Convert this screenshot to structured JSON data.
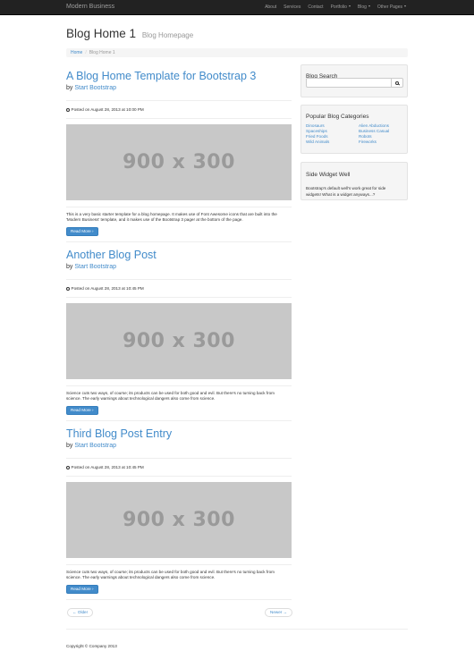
{
  "navbar": {
    "brand": "Modern Business",
    "items": [
      {
        "label": "About"
      },
      {
        "label": "Services"
      },
      {
        "label": "Contact"
      },
      {
        "label": "Portfolio"
      },
      {
        "label": "Blog"
      },
      {
        "label": "Other Pages"
      }
    ]
  },
  "header": {
    "title": "Blog Home 1",
    "subtitle": "Blog Homepage"
  },
  "breadcrumb": {
    "home": "Home",
    "current": "Blog Home 1"
  },
  "posts": [
    {
      "title": "A Blog Home Template for Bootstrap 3",
      "by": "by",
      "author": "Start Bootstrap",
      "posted": "Posted on August 28, 2013 at 10:00 PM",
      "image_label": "900 x 300",
      "excerpt": "This is a very basic starter template for a blog homepage. It makes use of Font Awesome icons that are built into the 'Modern Business' template, and it makes use of the Bootstrap 3 pager at the bottom of the page.",
      "button": "Read More"
    },
    {
      "title": "Another Blog Post",
      "by": "by",
      "author": "Start Bootstrap",
      "posted": "Posted on August 28, 2013 at 10:45 PM",
      "image_label": "900 x 300",
      "excerpt": "Science cuts two ways, of course; its products can be used for both good and evil. But there's no turning back from science. The early warnings about technological dangers also come from science.",
      "button": "Read More"
    },
    {
      "title": "Third Blog Post Entry",
      "by": "by",
      "author": "Start Bootstrap",
      "posted": "Posted on August 28, 2013 at 10:45 PM",
      "image_label": "900 x 300",
      "excerpt": "Science cuts two ways, of course; its products can be used for both good and evil. But there's no turning back from science. The early warnings about technological dangers also come from science.",
      "button": "Read More"
    }
  ],
  "pager": {
    "older": "← Older",
    "newer": "Newer →"
  },
  "footer": {
    "copyright": "Copyright © Company 2013"
  },
  "sidebar": {
    "search_title": "Blog Search",
    "categories_title": "Popular Blog Categories",
    "categories_left": [
      "Dinosaurs",
      "Spaceships",
      "Fried Foods",
      "Wild Animals"
    ],
    "categories_right": [
      "Alien Abductions",
      "Business Casual",
      "Robots",
      "Fireworks"
    ],
    "widget_title": "Side Widget Well",
    "widget_text": "Bootstrap's default well's work great for side widgets! What is a widget anyways...?"
  },
  "colors": {
    "navbar_bg": "#222222",
    "link": "#428bca",
    "primary_button": "#428bca",
    "placeholder_bg": "#c8c8c8"
  }
}
